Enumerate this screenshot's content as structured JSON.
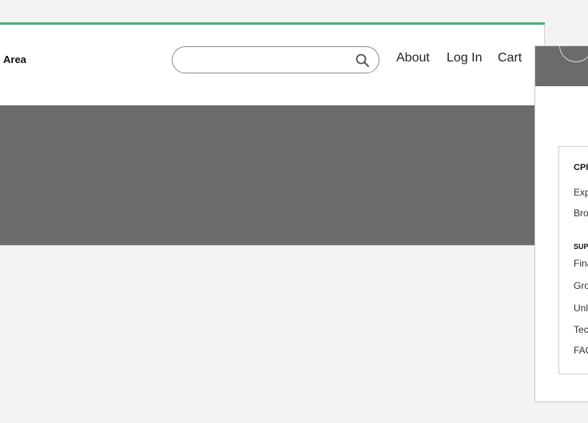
{
  "colors": {
    "accent": "#4caf7d",
    "hero": "#6b6b6b",
    "page_background": "#f3f3f3"
  },
  "header": {
    "brand_text": "Area",
    "search": {
      "value": "",
      "placeholder": "",
      "icon": "search-icon"
    },
    "nav": {
      "about": "About",
      "login": "Log In",
      "cart": "Cart"
    }
  },
  "drawer": {
    "sections": [
      {
        "heading": "CPI",
        "items": [
          "Exp",
          "Bro"
        ]
      },
      {
        "heading": "SUP",
        "items": [
          "Fina",
          "Gro",
          "Unli",
          "Tec",
          "FAC"
        ]
      }
    ]
  }
}
